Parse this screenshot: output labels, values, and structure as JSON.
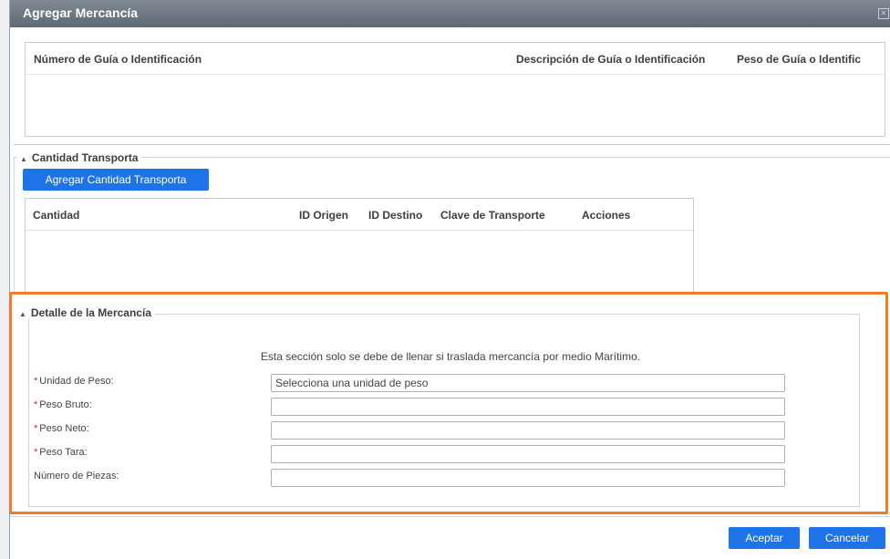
{
  "dialog": {
    "title": "Agregar Mercancía",
    "close_icon": "close-icon"
  },
  "guias_table": {
    "columns": [
      "Número de Guía o Identificación",
      "Descripción de Guía o Identificación",
      "Peso de Guía o Identific"
    ]
  },
  "cantidad_transporta": {
    "legend": "Cantidad Transporta",
    "add_button": "Agregar Cantidad Transporta",
    "columns": [
      "Cantidad",
      "ID Origen",
      "ID Destino",
      "Clave de Transporte",
      "Acciones"
    ]
  },
  "detalle": {
    "legend": "Detalle de la Mercancía",
    "note": "Esta sección solo se debe de llenar si traslada mercancía por medio Marítimo.",
    "fields": [
      {
        "label": "Unidad de Peso:",
        "required": true,
        "value": "Selecciona una unidad de peso"
      },
      {
        "label": "Peso Bruto:",
        "required": true,
        "value": ""
      },
      {
        "label": "Peso Neto:",
        "required": true,
        "value": ""
      },
      {
        "label": "Peso Tara:",
        "required": true,
        "value": ""
      },
      {
        "label": "Número de Piezas:",
        "required": false,
        "value": ""
      }
    ]
  },
  "footer": {
    "accept": "Aceptar",
    "cancel": "Cancelar"
  },
  "colors": {
    "accent": "#1e73e8",
    "highlight": "#f07c2a",
    "titlebar": "#6b757f",
    "required": "#d32f2f"
  }
}
